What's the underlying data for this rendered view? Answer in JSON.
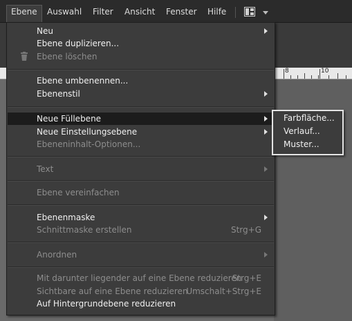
{
  "menubar": {
    "items": [
      "Ebene",
      "Auswahl",
      "Filter",
      "Ansicht",
      "Fenster",
      "Hilfe"
    ],
    "active_index": 0,
    "layout_icon": "window-layout-icon",
    "dropdown_icon": "chevron-down-icon"
  },
  "ruler": {
    "labels": [
      "8",
      "10"
    ]
  },
  "menu": {
    "items": [
      {
        "label": "Neu",
        "submenu": true,
        "enabled": true
      },
      {
        "label": "Ebene duplizieren...",
        "enabled": true
      },
      {
        "label": "Ebene löschen",
        "enabled": false,
        "icon": "trash-icon"
      },
      {
        "label": "Ebene umbenennen...",
        "enabled": true
      },
      {
        "label": "Ebenenstil",
        "submenu": true,
        "enabled": true
      },
      {
        "label": "Neue Füllebene",
        "submenu": true,
        "enabled": true,
        "highlighted": true
      },
      {
        "label": "Neue Einstellungsebene",
        "submenu": true,
        "enabled": true
      },
      {
        "label": "Ebeneninhalt-Optionen...",
        "enabled": false
      },
      {
        "label": "Text",
        "submenu": true,
        "enabled": false
      },
      {
        "label": "Ebene vereinfachen",
        "enabled": false
      },
      {
        "label": "Ebenenmaske",
        "submenu": true,
        "enabled": true
      },
      {
        "label": "Schnittmaske erstellen",
        "shortcut": "Strg+G",
        "enabled": false
      },
      {
        "label": "Anordnen",
        "submenu": true,
        "enabled": false
      },
      {
        "label": "Mit darunter liegender auf eine Ebene reduzieren",
        "shortcut": "Strg+E",
        "enabled": false
      },
      {
        "label": "Sichtbare auf eine Ebene reduzieren",
        "shortcut": "Umschalt+Strg+E",
        "enabled": false
      },
      {
        "label": "Auf Hintergrundebene reduzieren",
        "enabled": true
      }
    ]
  },
  "submenu": {
    "items": [
      "Farbfläche...",
      "Verlauf...",
      "Muster..."
    ]
  }
}
